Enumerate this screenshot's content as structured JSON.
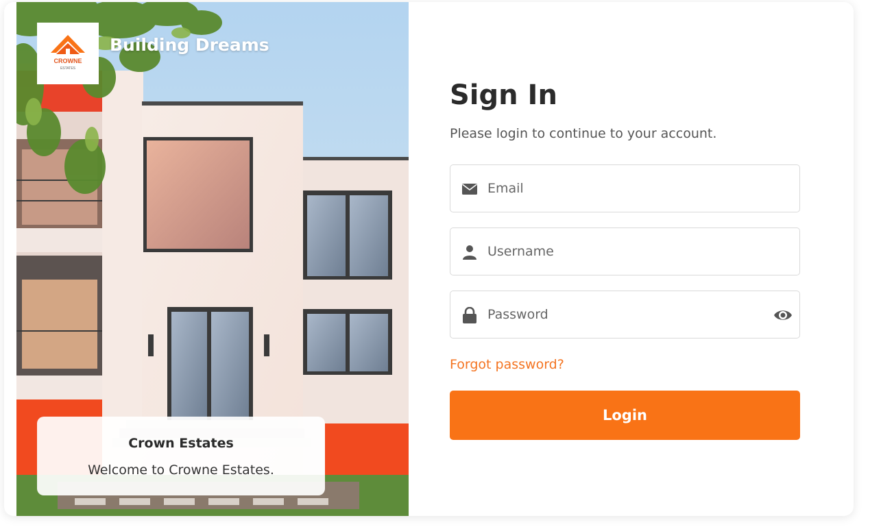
{
  "hero": {
    "tagline": "Building Dreams",
    "logo": {
      "icon": "house-roof-icon",
      "brand_line1": "CROWNE",
      "brand_line2": "ESTATES"
    },
    "welcome": {
      "name": "Crown Estates",
      "message": "Welcome to Crowne Estates."
    }
  },
  "form": {
    "title": "Sign In",
    "subtitle": "Please login to continue to your account.",
    "email": {
      "placeholder": "Email",
      "value": "",
      "icon": "envelope-icon"
    },
    "username": {
      "placeholder": "Username",
      "value": "",
      "icon": "user-icon"
    },
    "password": {
      "placeholder": "Password",
      "value": "",
      "icon": "lock-icon",
      "toggle_icon": "eye-icon"
    },
    "forgot_label": "Forgot password?",
    "login_label": "Login"
  },
  "colors": {
    "accent": "#f97316",
    "link": "#f47421",
    "title": "#2b2b2b"
  }
}
